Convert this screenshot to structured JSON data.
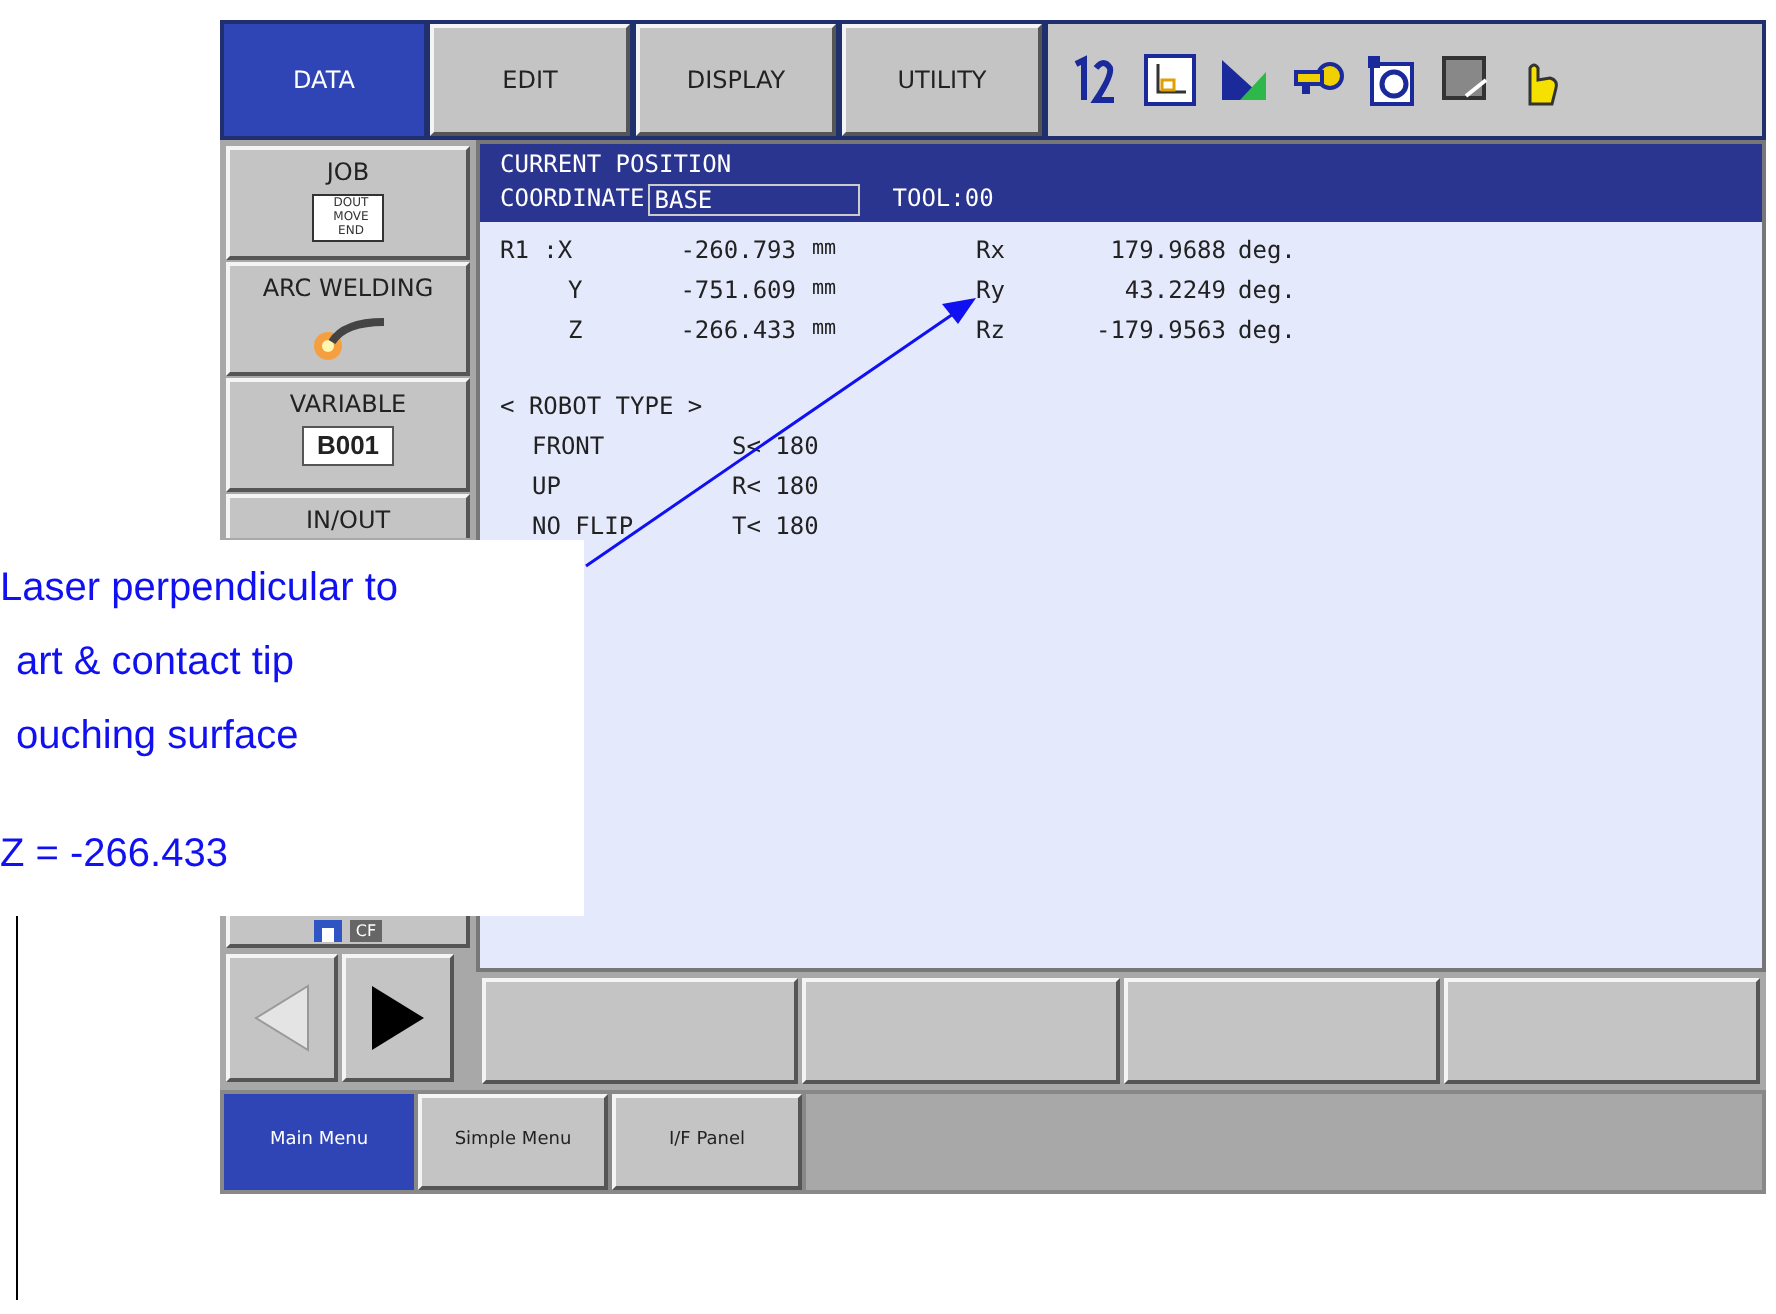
{
  "top_tabs": [
    {
      "label": "DATA",
      "selected": true
    },
    {
      "label": "EDIT",
      "selected": false
    },
    {
      "label": "DISPLAY",
      "selected": false
    },
    {
      "label": "UTILITY",
      "selected": false
    }
  ],
  "side_menu": [
    {
      "label": "JOB",
      "kind": "job",
      "icon_lines": [
        "DOUT",
        "MOVE",
        "END"
      ]
    },
    {
      "label": "ARC WELDING",
      "kind": "arc"
    },
    {
      "label": "VARIABLE",
      "kind": "variable",
      "value": "B001"
    },
    {
      "label": "IN/OUT",
      "kind": "io"
    }
  ],
  "storage_button": {
    "cf_label": "CF"
  },
  "panel": {
    "title": "CURRENT POSITION",
    "coordinate_label": "COORDINATE",
    "coordinate_value": "BASE",
    "tool": "TOOL:00",
    "axes": [
      {
        "axis": "R1 :X",
        "value": "-260.793",
        "unit": "mm",
        "r_axis": "Rx",
        "r_value": "179.9688",
        "r_unit": "deg."
      },
      {
        "axis": "Y",
        "value": "-751.609",
        "unit": "mm",
        "r_axis": "Ry",
        "r_value": "43.2249",
        "r_unit": "deg."
      },
      {
        "axis": "Z",
        "value": "-266.433",
        "unit": "mm",
        "r_axis": "Rz",
        "r_value": "-179.9563",
        "r_unit": "deg."
      }
    ],
    "robot_type_title": "< ROBOT TYPE >",
    "robot_type": [
      {
        "label": "FRONT",
        "limit": "S< 180"
      },
      {
        "label": "UP",
        "limit": "R< 180"
      },
      {
        "label": "NO FLIP",
        "limit": "T< 180"
      }
    ]
  },
  "bottom_tabs": [
    {
      "label": "Main Menu",
      "selected": true
    },
    {
      "label": "Simple Menu",
      "selected": false
    },
    {
      "label": "I/F Panel",
      "selected": false
    }
  ],
  "callout": {
    "lines": [
      "Laser perpendicular to",
      "art & contact tip",
      "ouching surface"
    ],
    "value": "Z = -266.433"
  }
}
